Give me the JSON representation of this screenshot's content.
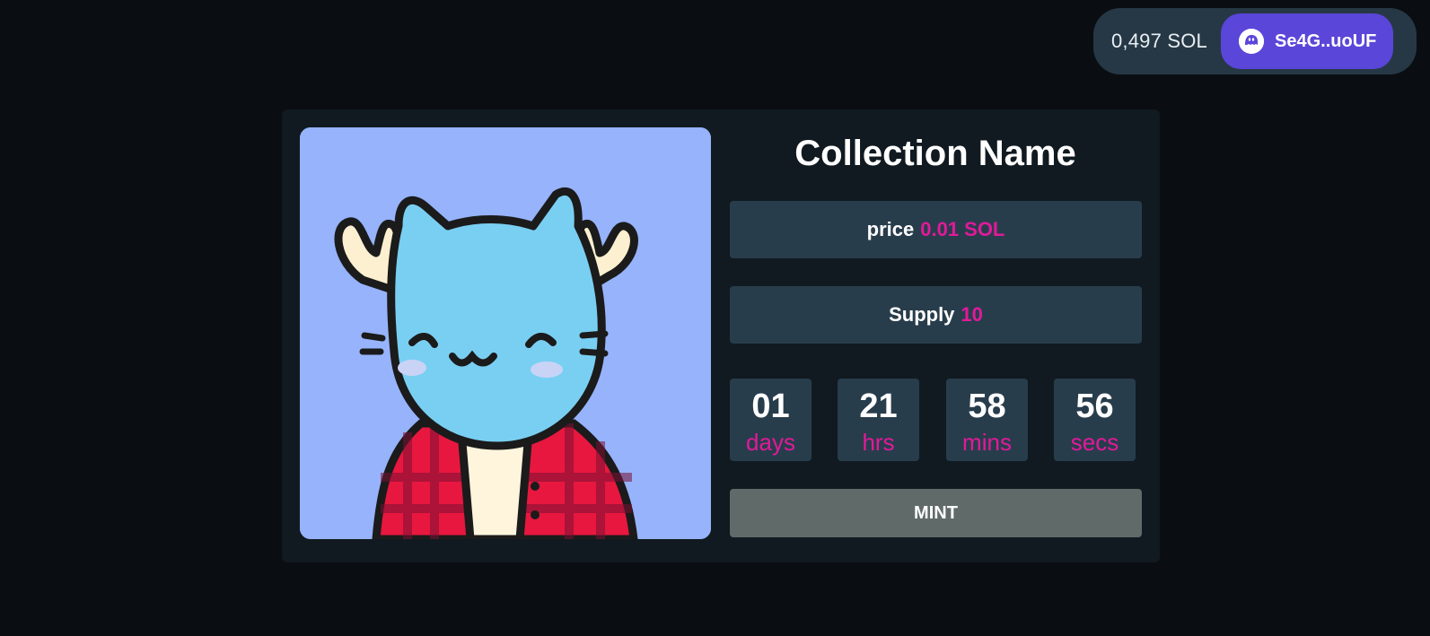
{
  "wallet": {
    "balance": "0,497 SOL",
    "address": "Se4G..uoUF",
    "icon": "phantom-ghost-icon"
  },
  "collection": {
    "name": "Collection Name",
    "image_alt": "cartoon blue cat with antlers wearing red plaid shirt",
    "price": {
      "label": "price",
      "value": "0.01 SOL"
    },
    "supply": {
      "label": "Supply",
      "value": "10"
    },
    "countdown": [
      {
        "value": "01",
        "unit": "days"
      },
      {
        "value": "21",
        "unit": "hrs"
      },
      {
        "value": "58",
        "unit": "mins"
      },
      {
        "value": "56",
        "unit": "secs"
      }
    ],
    "mint_label": "MINT"
  },
  "colors": {
    "background": "#0a0e12",
    "card": "#111a20",
    "panel": "#283d4c",
    "accent": "#e11a99",
    "wallet_button": "#5a46d9",
    "mint_button": "#5f6a69"
  }
}
